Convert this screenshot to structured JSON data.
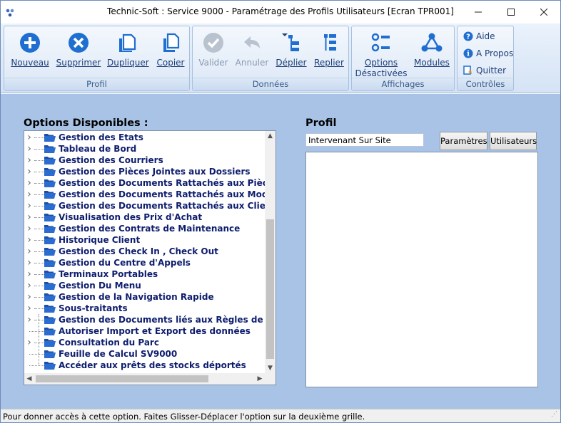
{
  "window": {
    "title": "Technic-Soft : Service 9000 - Paramétrage des Profils Utilisateurs [Ecran TPR001]"
  },
  "ribbon": {
    "groups": {
      "profil": {
        "label": "Profil",
        "buttons": {
          "nouveau": "Nouveau",
          "supprimer": "Supprimer",
          "dupliquer": "Dupliquer",
          "copier": "Copier"
        }
      },
      "donnees": {
        "label": "Données",
        "buttons": {
          "valider": "Valider",
          "annuler": "Annuler",
          "deplier": "Déplier",
          "replier": "Replier"
        }
      },
      "affichages": {
        "label": "Affichages",
        "buttons": {
          "options_line1": "Options",
          "options_line2": "Désactivées",
          "modules": "Modules"
        }
      },
      "controles": {
        "label": "Contrôles",
        "buttons": {
          "aide": "Aide",
          "apropos": "A Propos",
          "quitter": "Quitter"
        }
      }
    },
    "accent": "#1f6fd0"
  },
  "options": {
    "title": "Options Disponibles :",
    "items": [
      "Gestion des Etats",
      "Tableau de Bord",
      "Gestion des Courriers",
      "Gestion des Pièces Jointes aux Dossiers",
      "Gestion des Documents Rattachés aux Pièces D",
      "Gestion des Documents Rattachés aux Modèle",
      "Gestion des Documents Rattachés aux Clients",
      "Visualisation des Prix d'Achat",
      "Gestion des Contrats de Maintenance",
      "Historique Client",
      "Gestion des Check In , Check Out",
      "Gestion du Centre d'Appels",
      "Terminaux Portables",
      "Gestion Du Menu",
      "Gestion de la Navigation Rapide",
      "Sous-traitants",
      "Gestion des Documents liés aux Règles de ratt",
      "Autoriser Import et Export des données",
      "Consultation du Parc",
      "Feuille de Calcul SV9000",
      "Accéder aux prêts des stocks déportés"
    ]
  },
  "profil": {
    "title": "Profil",
    "input_value": "Intervenant Sur Site",
    "tab_parametres": "Paramètres",
    "tab_utilisateurs": "Utilisateurs"
  },
  "status": {
    "text": "Pour donner accès à cette option. Faites Glisser-Déplacer l'option sur la deuxième grille."
  }
}
